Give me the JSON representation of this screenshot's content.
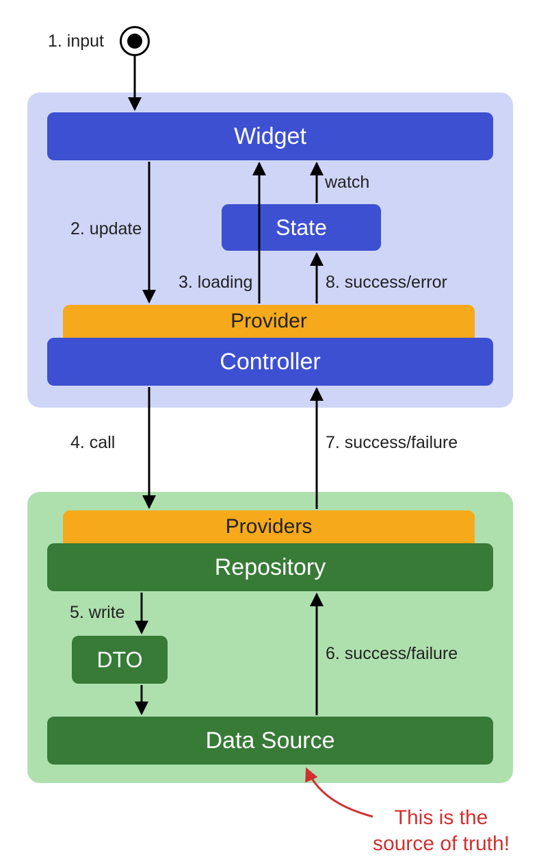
{
  "diagram": {
    "start_label": "1. input",
    "top_panel": {
      "widget": "Widget",
      "state": "State",
      "provider": "Provider",
      "controller": "Controller",
      "edge_update": "2. update",
      "edge_loading": "3. loading",
      "edge_watch": "watch",
      "edge_success_error": "8. success/error"
    },
    "mid": {
      "edge_call": "4. call",
      "edge_success_failure_up": "7. success/failure"
    },
    "bottom_panel": {
      "providers": "Providers",
      "repository": "Repository",
      "dto": "DTO",
      "data_source": "Data Source",
      "edge_write": "5. write",
      "edge_success_failure": "6. success/failure"
    },
    "annotation": "This is the\nsource of truth!"
  },
  "colors": {
    "blue": "#3d50d2",
    "blue_light": "#cfd5f6",
    "green": "#377b37",
    "green_light": "#aee0ae",
    "orange": "#f5a91b",
    "red": "#d03030"
  }
}
